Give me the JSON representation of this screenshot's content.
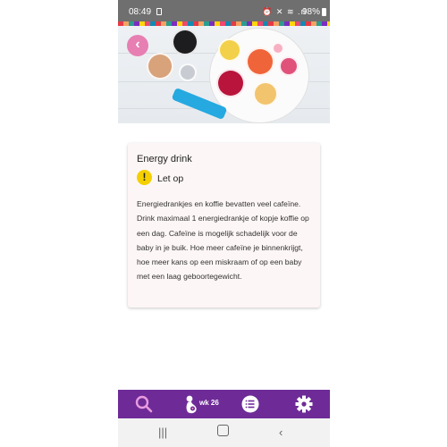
{
  "status_bar": {
    "time": "08:49",
    "indicators": "⏰ ✕ ≋ .ıl",
    "battery": "98%"
  },
  "hero": {
    "back_icon": "chevron-left-icon",
    "accent_color": "#e77fb3"
  },
  "card": {
    "title": "Energy drink",
    "warning_label": "Let op",
    "warning_color": "#f4d000",
    "body": "Energiedrankjes en koffie bevatten veel cafeïne. Drink maximaal 1 energiedrankje of kopje koffie op een dag. Cafeïne is mogelijk schadelijk voor de baby in je buik. Hoe meer cafeïne je binnenkrijgt, hoe meer kans op een miskraam of op een baby met een laag geboortegewicht."
  },
  "bottom_nav": {
    "color": "#6e2b97",
    "search_icon": "search-icon",
    "week_label": "wk 26",
    "list_icon": "list-icon",
    "settings_icon": "gear-icon"
  },
  "android_nav": {
    "recents_icon": "recents-icon",
    "home_icon": "home-icon",
    "back_icon": "back-icon"
  }
}
